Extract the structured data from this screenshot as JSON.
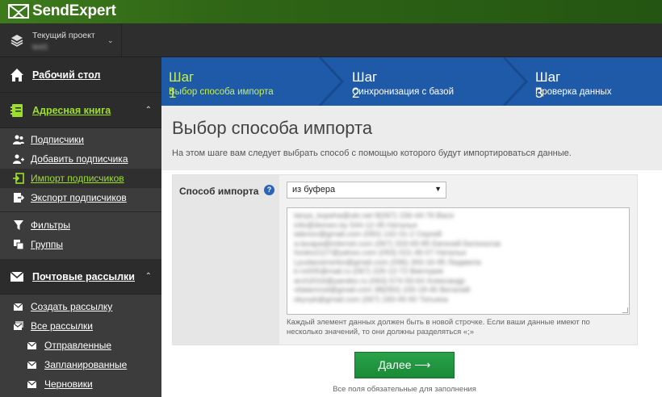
{
  "brand": {
    "name": "SendExpert"
  },
  "project": {
    "label": "Текущий проект",
    "name": "test1"
  },
  "sidebar": {
    "dashboard": "Рабочий стол",
    "address_book": "Адресная книга",
    "subscribers": "Подписчики",
    "add_subscriber": "Добавить подписчика",
    "import_subscribers": "Импорт подписчиков",
    "export_subscribers": "Экспорт подписчиков",
    "filters": "Фильтры",
    "groups": "Группы",
    "mailings": "Почтовые рассылки",
    "create_mailing": "Создать рассылку",
    "all_mailings": "Все рассылки",
    "sent": "Отправленные",
    "scheduled": "Запланированные",
    "drafts": "Черновики"
  },
  "steps": [
    {
      "num": "Шаг 1",
      "label": "Выбор способа импорта",
      "active": true
    },
    {
      "num": "Шаг 2",
      "label": "Синхронизация с базой",
      "active": false
    },
    {
      "num": "Шаг 3",
      "label": "Проверка данных",
      "active": false
    }
  ],
  "page": {
    "title": "Выбор способа импорта",
    "description": "На этом шаге вам следует выбрать способ с помощью которого будут импортироваться данные."
  },
  "form": {
    "import_method_label": "Способ импорта",
    "help_glyph": "?",
    "selected_method": "из буфера",
    "buffer_lines": [
      "tanya_kopeha@ukr.net        8(067) 156-44-76        Вася",
      "info@domen.by 544-12-45 Наталья",
      "talenov@gmail.com     (050) 142-31-2 Сергей",
      "a.lavapa@internet.com         (067) 333-65-85 Евгений Белоногов",
      "hooks2127@yahoo.com (093) 021-46-07 Наталья",
      "Lyudaosimerko@gmail.com       (096) 393-16-95 Людмила",
      "k-ro005@mail.ru          (067) 225-12-72 Виктория",
      "arch2016@yandex.ru (063) 574-93-64 Александр",
      "vitalamrod@gmail.com    38(050) 155-18-45        Виталий",
      "okyvyk@gmail.com (067) 183-45-90        Татьяна"
    ],
    "hint": "Каждый элемент данных должен быть в новой строчке. Если ваши данные имеют по несколько значений, то они должны разделяться «;»"
  },
  "actions": {
    "next_label": "Далее ⟶",
    "required_note": "Все поля обязательные для заполнения"
  },
  "colors": {
    "brand_green": "#2f6516",
    "step_blue": "#1f5aa8",
    "active_lime": "#9be02a",
    "button_green": "#1a8a37"
  }
}
